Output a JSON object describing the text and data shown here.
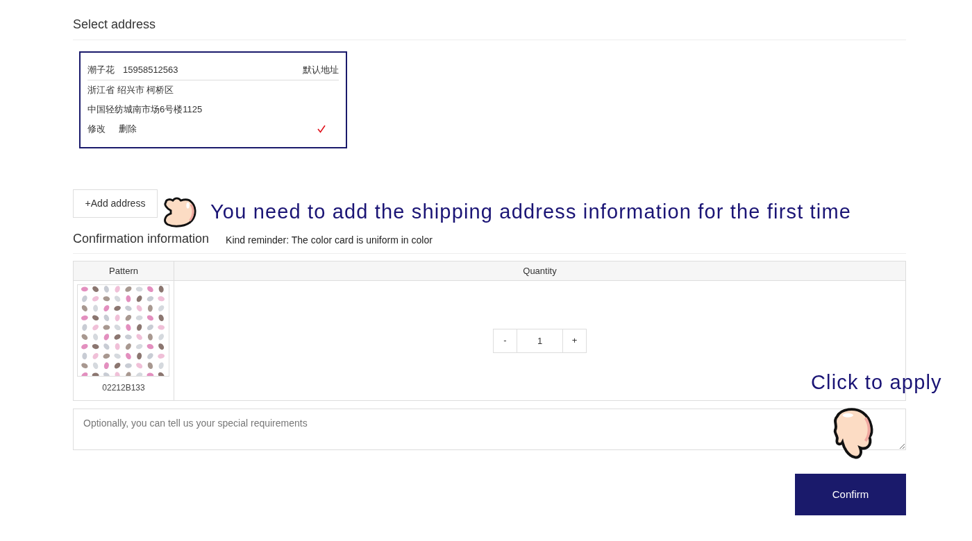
{
  "address_section": {
    "title": "Select address"
  },
  "addresses": [
    {
      "name": "潮子花",
      "phone": "15958512563",
      "default_label": "默认地址",
      "region": "浙江省 绍兴市 柯桥区",
      "street": "中国轻纺城南市场6号楼1125",
      "actions": [
        "修改",
        "删除"
      ],
      "selected": true
    }
  ],
  "add_address_button": "+Add address",
  "confirmation": {
    "title": "Confirmation information",
    "reminder": "Kind reminder: The color card is uniform in color"
  },
  "table": {
    "columns": [
      "Pattern",
      "Quantity"
    ],
    "rows": [
      {
        "pattern_code": "02212B133",
        "decrement": "-",
        "quantity": "1",
        "increment": "+"
      }
    ]
  },
  "requirements": {
    "placeholder": "Optionally, you can tell us your special requirements"
  },
  "confirm_button": "Confirm",
  "annotations": [
    {
      "kind": "point-left",
      "text": "You need to add the shipping address information for the first time"
    },
    {
      "kind": "point-down",
      "text": "Click to apply"
    }
  ]
}
